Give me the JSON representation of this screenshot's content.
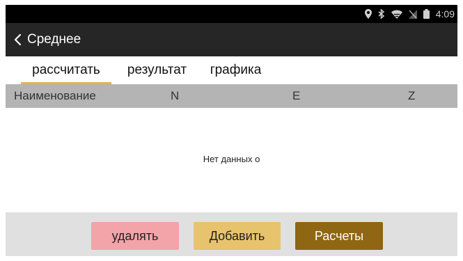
{
  "status_bar": {
    "time": "4:09",
    "icons": [
      "location-icon",
      "bluetooth-icon",
      "wifi-icon",
      "no-sim-icon",
      "battery-icon"
    ]
  },
  "header": {
    "back_icon": "chevron-left-icon",
    "title": "Среднее"
  },
  "tabs": [
    {
      "label": "рассчитать",
      "active": true
    },
    {
      "label": "результат",
      "active": false
    },
    {
      "label": "графика",
      "active": false
    }
  ],
  "table": {
    "columns": [
      "Наименование",
      "N",
      "E",
      "Z"
    ],
    "empty_message": "Нет данных о"
  },
  "actions": {
    "delete_label": "удалять",
    "add_label": "Добавить",
    "calculate_label": "Расчеты"
  },
  "colors": {
    "status_bar": "#000000",
    "app_bar": "#262626",
    "tab_indicator": "#e3b24a",
    "table_header": "#b4b4b4",
    "bottom_bar": "#e0e0e0",
    "delete_button": "#f2a4a9",
    "add_button": "#e8c36d",
    "calculate_button": "#8f6612"
  }
}
